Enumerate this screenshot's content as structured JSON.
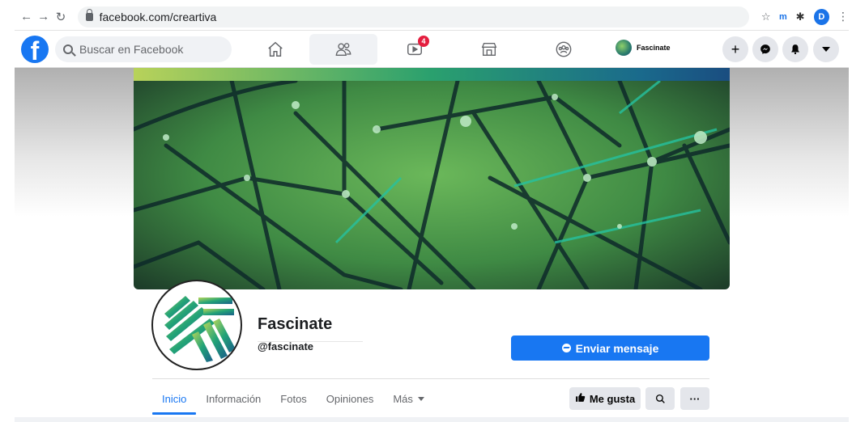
{
  "browser": {
    "url": "facebook.com/creartiva",
    "back_icon": "arrow-left-icon",
    "forward_icon": "arrow-right-icon",
    "reload_icon": "reload-icon",
    "profile_initial": "D"
  },
  "fb_nav": {
    "search_placeholder": "Buscar en Facebook",
    "notification_badge": "4",
    "page_chip_label": "Fascinate",
    "colors": {
      "brand": "#1877f2",
      "badge": "#e41e3f"
    }
  },
  "profile": {
    "name": "Fascinate",
    "handle": "@fascinate",
    "send_message_label": "Enviar mensaje"
  },
  "tabs": [
    {
      "label": "Inicio",
      "active": true
    },
    {
      "label": "Información",
      "active": false
    },
    {
      "label": "Fotos",
      "active": false
    },
    {
      "label": "Opiniones",
      "active": false
    },
    {
      "label": "Más",
      "active": false
    }
  ],
  "actions": {
    "like_label": "Me gusta",
    "more_label": "···"
  }
}
